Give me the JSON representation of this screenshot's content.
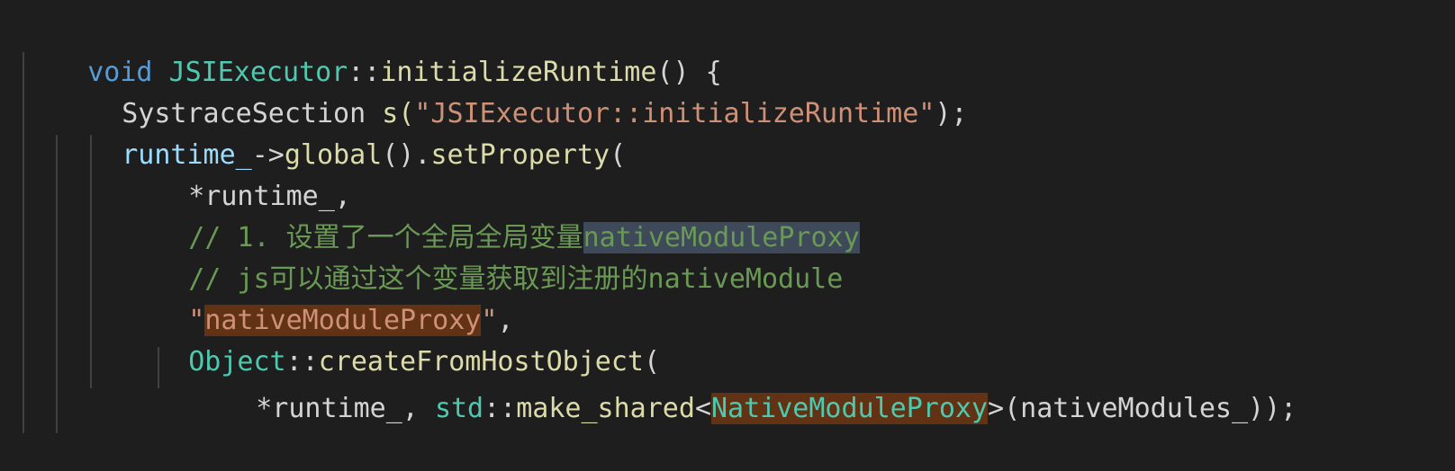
{
  "code": {
    "line1": {
      "kw_void": "void",
      "class_name": "JSIExecutor",
      "scope": "::",
      "fn_name": "initializeRuntime",
      "tail": "() {"
    },
    "line2": {
      "type": "SystraceSection",
      "var": " s(",
      "str": "\"JSIExecutor::initializeRuntime\"",
      "tail": ");"
    },
    "line3": {
      "var": "runtime_",
      "arrow": "->",
      "fn1": "global",
      "mid": "().",
      "fn2": "setProperty",
      "tail": "("
    },
    "line4": {
      "text": "*runtime_,"
    },
    "line5": {
      "comment": "// 1. 设置了一个全局全局变量",
      "highlight": "nativeModuleProxy"
    },
    "line6": {
      "comment": "// js可以通过这个变量获取到注册的nativeModule"
    },
    "line7": {
      "quote_open": "\"",
      "str_hl": "nativeModuleProxy",
      "quote_close": "\"",
      "tail": ","
    },
    "line8": {
      "cls": "Object",
      "scope": "::",
      "fn": "createFromHostObject",
      "tail": "("
    },
    "line9": {
      "lead": "*runtime_, ",
      "ns": "std",
      "scope": "::",
      "fn": "make_shared",
      "lt": "<",
      "cls_hl": "NativeModuleProxy",
      "gt": ">",
      "tail": "(nativeModules_));"
    }
  }
}
